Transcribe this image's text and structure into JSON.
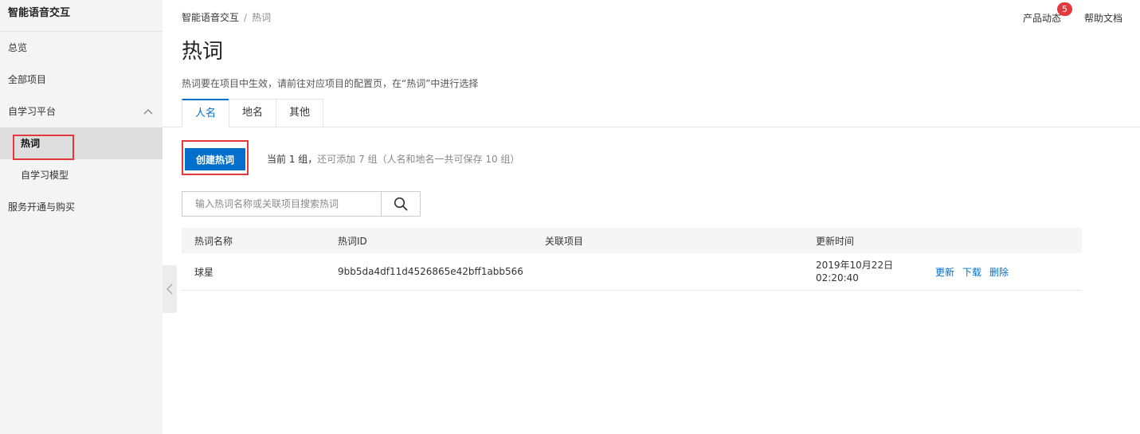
{
  "sidebar": {
    "title": "智能语音交互",
    "items": [
      {
        "label": "总览"
      },
      {
        "label": "全部项目"
      },
      {
        "label": "自学习平台"
      },
      {
        "label": "热词"
      },
      {
        "label": "自学习模型"
      },
      {
        "label": "服务开通与购买"
      }
    ]
  },
  "header": {
    "breadcrumb": [
      "智能语音交互",
      "热词"
    ],
    "breadcrumb_sep": "/",
    "product_news": "产品动态",
    "product_news_badge": "5",
    "help_docs": "帮助文档"
  },
  "page": {
    "title": "热词",
    "description": "热词要在项目中生效，请前往对应项目的配置页，在“热词”中进行选择"
  },
  "tabs": [
    {
      "label": "人名",
      "active": true
    },
    {
      "label": "地名",
      "active": false
    },
    {
      "label": "其他",
      "active": false
    }
  ],
  "toolbar": {
    "create_label": "创建热词",
    "quota_current": "当前 1 组，",
    "quota_rest": "还可添加 7 组（人名和地名一共可保存 10 组）"
  },
  "search": {
    "placeholder": "输入热词名称或关联项目搜索热词",
    "value": ""
  },
  "table": {
    "columns": [
      "热词名称",
      "热词ID",
      "关联项目",
      "更新时间",
      ""
    ],
    "rows": [
      {
        "name": "球星",
        "id": "9bb5da4df11d4526865e42bff1abb566",
        "project": "",
        "date": "2019年10月22日",
        "time": "02:20:40",
        "actions": [
          "更新",
          "下载",
          "删除"
        ]
      }
    ]
  },
  "colors": {
    "primary": "#0070cc",
    "highlight": "#e4393c",
    "sidebar_bg": "#f4f4f4"
  }
}
